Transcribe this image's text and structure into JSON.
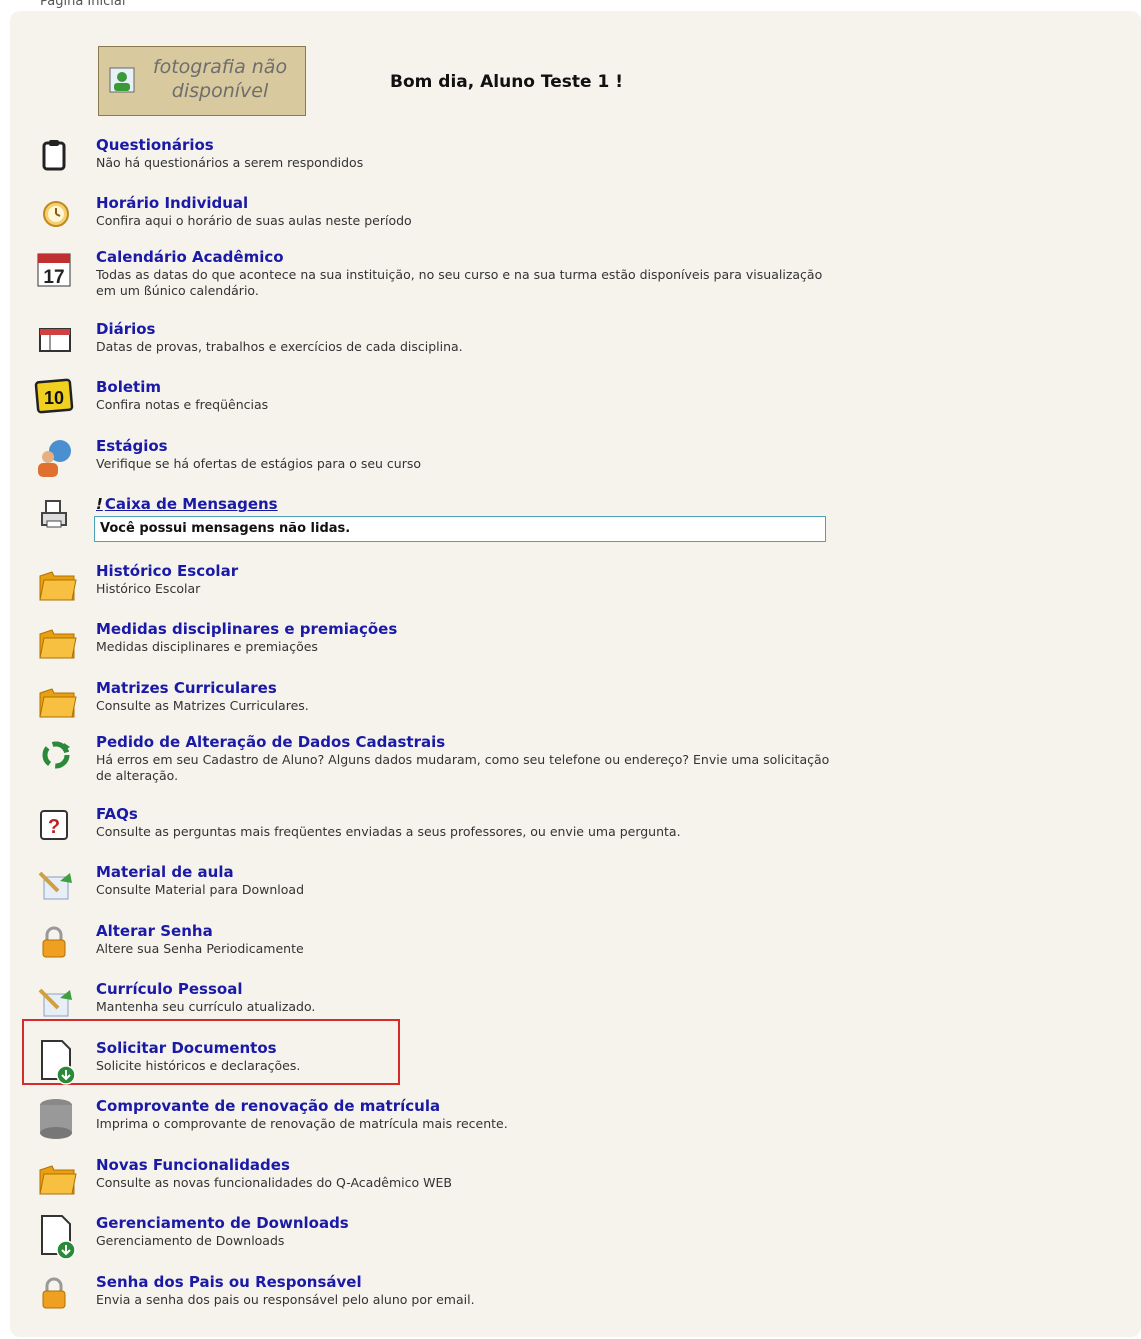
{
  "breadcrumb": "Página Inicial",
  "photo": {
    "text_line1": "fotografia não",
    "text_line2": "disponível"
  },
  "greeting": "Bom dia, Aluno Teste 1 !",
  "items": [
    {
      "title": "Questionários",
      "desc": "Não há questionários a serem respondidos",
      "icon": "clipboard-icon"
    },
    {
      "title": "Horário Individual",
      "desc": "Confira aqui o horário de suas aulas neste período",
      "icon": "clock-icon"
    },
    {
      "title": "Calendário Acadêmico",
      "desc": "Todas as datas do que acontece na sua instituição, no seu curso e na sua turma estão disponíveis para visualização em um ßúnico calendário.",
      "icon": "calendar-icon",
      "calendar_day": "17"
    },
    {
      "title": "Diários",
      "desc": "Datas de provas, trabalhos e exercícios de cada disciplina.",
      "icon": "table-icon"
    },
    {
      "title": "Boletim",
      "desc": "Confira notas e freqüências",
      "icon": "grade-icon",
      "grade_number": "10"
    },
    {
      "title": "Estágios",
      "desc": "Verifique se há ofertas de estágios para o seu curso",
      "icon": "person-globe-icon"
    },
    {
      "title": "Caixa de Mensagens",
      "prefix": "!",
      "desc": "Você possui mensagens não lidas.",
      "icon": "printer-icon"
    },
    {
      "title": "Histórico Escolar",
      "desc": "Histórico Escolar",
      "icon": "folder-icon"
    },
    {
      "title": "Medidas disciplinares e premiações",
      "desc": "Medidas disciplinares e premiações",
      "icon": "folder-icon"
    },
    {
      "title": "Matrizes Curriculares",
      "desc": "Consulte as Matrizes Curriculares.",
      "icon": "folder-icon"
    },
    {
      "title": "Pedido de Alteração de Dados Cadastrais",
      "desc": "Há erros em seu Cadastro de Aluno? Alguns dados mudaram, como seu telefone ou endereço? Envie uma solicitação de alteração.",
      "icon": "recycle-icon"
    },
    {
      "title": "FAQs",
      "desc": "Consulte as perguntas mais freqüentes enviadas a seus professores, ou envie uma pergunta.",
      "icon": "question-icon",
      "question_mark": "?"
    },
    {
      "title": "Material de aula",
      "desc": "Consulte Material para Download",
      "icon": "pencil-doc-icon"
    },
    {
      "title": "Alterar Senha",
      "desc": "Altere sua Senha Periodicamente",
      "icon": "lock-icon"
    },
    {
      "title": "Currículo Pessoal",
      "desc": "Mantenha seu currículo atualizado.",
      "icon": "pencil-doc-icon"
    },
    {
      "title": "Solicitar Documentos",
      "desc": "Solicite históricos e declarações.",
      "icon": "download-doc-icon"
    },
    {
      "title": "Comprovante de renovação de matrícula",
      "desc": "Imprima o comprovante de renovação de matrícula mais recente.",
      "icon": "database-icon"
    },
    {
      "title": "Novas Funcionalidades",
      "desc": "Consulte as novas funcionalidades do Q-Acadêmico WEB",
      "icon": "folder-icon"
    },
    {
      "title": "Gerenciamento de Downloads",
      "desc": "Gerenciamento de Downloads",
      "icon": "download-doc-icon"
    },
    {
      "title": "Senha dos Pais ou Responsável",
      "desc": "Envia a senha dos pais ou responsável pelo aluno por email.",
      "icon": "lock-icon"
    }
  ],
  "colors": {
    "link": "#1a1aa6",
    "panel": "#f5f3ec",
    "highlight": "#d62b2b"
  }
}
